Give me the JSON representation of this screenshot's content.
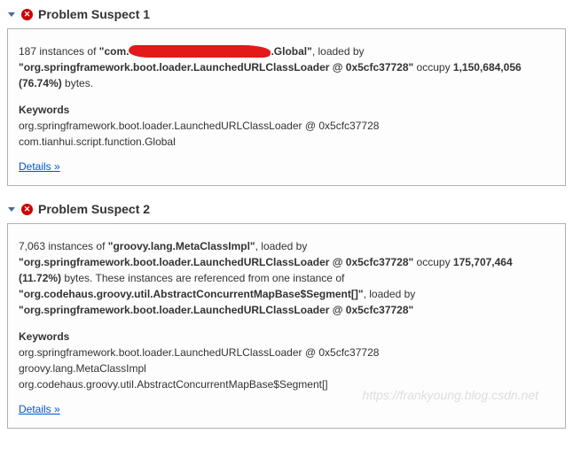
{
  "suspects": [
    {
      "title": "Problem Suspect 1",
      "instances_count": "187",
      "instances_label": " instances of ",
      "class_prefix": "\"com.",
      "class_suffix": ".Global\"",
      "loaded_by_text": ", loaded by ",
      "loader": "\"org.springframework.boot.loader.LaunchedURLClassLoader @ 0x5cfc37728\"",
      "occupy_text": " occupy ",
      "bytes_value": "1,150,684,056 (76.74%)",
      "bytes_label": " bytes.",
      "extra_text": "",
      "ref_class": "",
      "ref_loaded_by": "",
      "ref_loader": "",
      "keywords_label": "Keywords",
      "kw": [
        "org.springframework.boot.loader.LaunchedURLClassLoader @ 0x5cfc37728",
        "com.tianhui.script.function.Global"
      ],
      "details_label": "Details »",
      "redacted": true
    },
    {
      "title": "Problem Suspect 2",
      "instances_count": "7,063",
      "instances_label": " instances of ",
      "class_full": "\"groovy.lang.MetaClassImpl\"",
      "loaded_by_text": ", loaded by ",
      "loader": "\"org.springframework.boot.loader.LaunchedURLClassLoader @ 0x5cfc37728\"",
      "occupy_text": " occupy ",
      "bytes_value": "175,707,464 (11.72%)",
      "bytes_label": " bytes. These instances are referenced from one instance of ",
      "ref_class": "\"org.codehaus.groovy.util.AbstractConcurrentMapBase$Segment[]\"",
      "ref_loaded_by": ", loaded by ",
      "ref_loader": "\"org.springframework.boot.loader.LaunchedURLClassLoader @ 0x5cfc37728\"",
      "keywords_label": "Keywords",
      "kw": [
        "org.springframework.boot.loader.LaunchedURLClassLoader @ 0x5cfc37728",
        "groovy.lang.MetaClassImpl",
        "org.codehaus.groovy.util.AbstractConcurrentMapBase$Segment[]"
      ],
      "details_label": "Details »",
      "redacted": false
    }
  ],
  "watermark": "https://frankyoung.blog.csdn.net"
}
